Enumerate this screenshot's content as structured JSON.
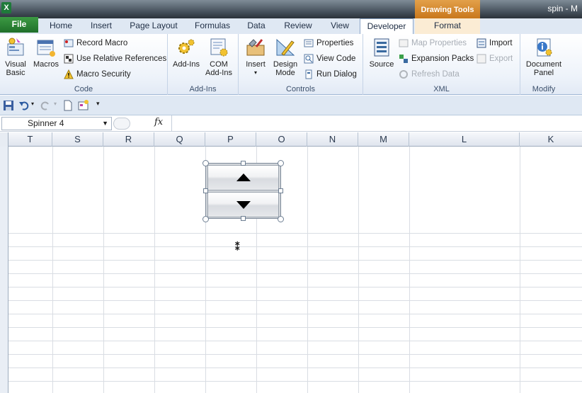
{
  "window": {
    "title": "spin - M",
    "app_icon": "excel-icon",
    "contextual_tools_label": "Drawing Tools"
  },
  "tabs": [
    {
      "label": "File"
    },
    {
      "label": "Home"
    },
    {
      "label": "Insert"
    },
    {
      "label": "Page Layout"
    },
    {
      "label": "Formulas"
    },
    {
      "label": "Data"
    },
    {
      "label": "Review"
    },
    {
      "label": "View"
    },
    {
      "label": "Developer"
    },
    {
      "label": "Format"
    }
  ],
  "active_tab": "Developer",
  "ribbon": {
    "code": {
      "label": "Code",
      "visual_basic": "Visual Basic",
      "macros": "Macros",
      "record_macro": "Record Macro",
      "relative_refs": "Use Relative References",
      "macro_security": "Macro Security"
    },
    "addins": {
      "label": "Add-Ins",
      "addins": "Add-Ins",
      "com_addins": "COM Add-Ins"
    },
    "controls": {
      "label": "Controls",
      "insert": "Insert",
      "design_mode": "Design Mode",
      "properties": "Properties",
      "view_code": "View Code",
      "run_dialog": "Run Dialog"
    },
    "xml": {
      "label": "XML",
      "source": "Source",
      "map_properties": "Map Properties",
      "expansion_packs": "Expansion Packs",
      "refresh_data": "Refresh Data",
      "import": "Import",
      "export": "Export"
    },
    "modify": {
      "label": "Modify",
      "document_panel": "Document Panel"
    }
  },
  "formula_bar": {
    "name_box": "Spinner 4",
    "fx": "fx",
    "value": ""
  },
  "columns": [
    "T",
    "S",
    "R",
    "Q",
    "P",
    "O",
    "N",
    "M",
    "L",
    "K"
  ],
  "colors": {
    "file_tab": "#2a8a37",
    "ribbon_bg": "#eef3fa",
    "contextual": "#d98a2e"
  }
}
